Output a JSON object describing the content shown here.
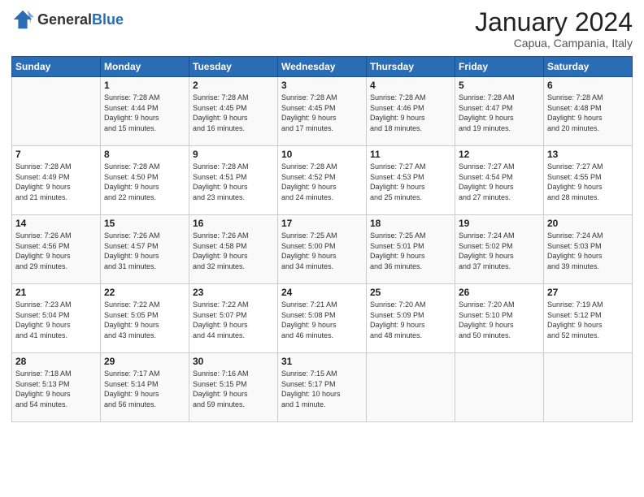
{
  "header": {
    "logo_general": "General",
    "logo_blue": "Blue",
    "month_title": "January 2024",
    "location": "Capua, Campania, Italy"
  },
  "days_of_week": [
    "Sunday",
    "Monday",
    "Tuesday",
    "Wednesday",
    "Thursday",
    "Friday",
    "Saturday"
  ],
  "weeks": [
    [
      {
        "day": "",
        "info": ""
      },
      {
        "day": "1",
        "info": "Sunrise: 7:28 AM\nSunset: 4:44 PM\nDaylight: 9 hours\nand 15 minutes."
      },
      {
        "day": "2",
        "info": "Sunrise: 7:28 AM\nSunset: 4:45 PM\nDaylight: 9 hours\nand 16 minutes."
      },
      {
        "day": "3",
        "info": "Sunrise: 7:28 AM\nSunset: 4:45 PM\nDaylight: 9 hours\nand 17 minutes."
      },
      {
        "day": "4",
        "info": "Sunrise: 7:28 AM\nSunset: 4:46 PM\nDaylight: 9 hours\nand 18 minutes."
      },
      {
        "day": "5",
        "info": "Sunrise: 7:28 AM\nSunset: 4:47 PM\nDaylight: 9 hours\nand 19 minutes."
      },
      {
        "day": "6",
        "info": "Sunrise: 7:28 AM\nSunset: 4:48 PM\nDaylight: 9 hours\nand 20 minutes."
      }
    ],
    [
      {
        "day": "7",
        "info": "Sunrise: 7:28 AM\nSunset: 4:49 PM\nDaylight: 9 hours\nand 21 minutes."
      },
      {
        "day": "8",
        "info": "Sunrise: 7:28 AM\nSunset: 4:50 PM\nDaylight: 9 hours\nand 22 minutes."
      },
      {
        "day": "9",
        "info": "Sunrise: 7:28 AM\nSunset: 4:51 PM\nDaylight: 9 hours\nand 23 minutes."
      },
      {
        "day": "10",
        "info": "Sunrise: 7:28 AM\nSunset: 4:52 PM\nDaylight: 9 hours\nand 24 minutes."
      },
      {
        "day": "11",
        "info": "Sunrise: 7:27 AM\nSunset: 4:53 PM\nDaylight: 9 hours\nand 25 minutes."
      },
      {
        "day": "12",
        "info": "Sunrise: 7:27 AM\nSunset: 4:54 PM\nDaylight: 9 hours\nand 27 minutes."
      },
      {
        "day": "13",
        "info": "Sunrise: 7:27 AM\nSunset: 4:55 PM\nDaylight: 9 hours\nand 28 minutes."
      }
    ],
    [
      {
        "day": "14",
        "info": "Sunrise: 7:26 AM\nSunset: 4:56 PM\nDaylight: 9 hours\nand 29 minutes."
      },
      {
        "day": "15",
        "info": "Sunrise: 7:26 AM\nSunset: 4:57 PM\nDaylight: 9 hours\nand 31 minutes."
      },
      {
        "day": "16",
        "info": "Sunrise: 7:26 AM\nSunset: 4:58 PM\nDaylight: 9 hours\nand 32 minutes."
      },
      {
        "day": "17",
        "info": "Sunrise: 7:25 AM\nSunset: 5:00 PM\nDaylight: 9 hours\nand 34 minutes."
      },
      {
        "day": "18",
        "info": "Sunrise: 7:25 AM\nSunset: 5:01 PM\nDaylight: 9 hours\nand 36 minutes."
      },
      {
        "day": "19",
        "info": "Sunrise: 7:24 AM\nSunset: 5:02 PM\nDaylight: 9 hours\nand 37 minutes."
      },
      {
        "day": "20",
        "info": "Sunrise: 7:24 AM\nSunset: 5:03 PM\nDaylight: 9 hours\nand 39 minutes."
      }
    ],
    [
      {
        "day": "21",
        "info": "Sunrise: 7:23 AM\nSunset: 5:04 PM\nDaylight: 9 hours\nand 41 minutes."
      },
      {
        "day": "22",
        "info": "Sunrise: 7:22 AM\nSunset: 5:05 PM\nDaylight: 9 hours\nand 43 minutes."
      },
      {
        "day": "23",
        "info": "Sunrise: 7:22 AM\nSunset: 5:07 PM\nDaylight: 9 hours\nand 44 minutes."
      },
      {
        "day": "24",
        "info": "Sunrise: 7:21 AM\nSunset: 5:08 PM\nDaylight: 9 hours\nand 46 minutes."
      },
      {
        "day": "25",
        "info": "Sunrise: 7:20 AM\nSunset: 5:09 PM\nDaylight: 9 hours\nand 48 minutes."
      },
      {
        "day": "26",
        "info": "Sunrise: 7:20 AM\nSunset: 5:10 PM\nDaylight: 9 hours\nand 50 minutes."
      },
      {
        "day": "27",
        "info": "Sunrise: 7:19 AM\nSunset: 5:12 PM\nDaylight: 9 hours\nand 52 minutes."
      }
    ],
    [
      {
        "day": "28",
        "info": "Sunrise: 7:18 AM\nSunset: 5:13 PM\nDaylight: 9 hours\nand 54 minutes."
      },
      {
        "day": "29",
        "info": "Sunrise: 7:17 AM\nSunset: 5:14 PM\nDaylight: 9 hours\nand 56 minutes."
      },
      {
        "day": "30",
        "info": "Sunrise: 7:16 AM\nSunset: 5:15 PM\nDaylight: 9 hours\nand 59 minutes."
      },
      {
        "day": "31",
        "info": "Sunrise: 7:15 AM\nSunset: 5:17 PM\nDaylight: 10 hours\nand 1 minute."
      },
      {
        "day": "",
        "info": ""
      },
      {
        "day": "",
        "info": ""
      },
      {
        "day": "",
        "info": ""
      }
    ]
  ]
}
